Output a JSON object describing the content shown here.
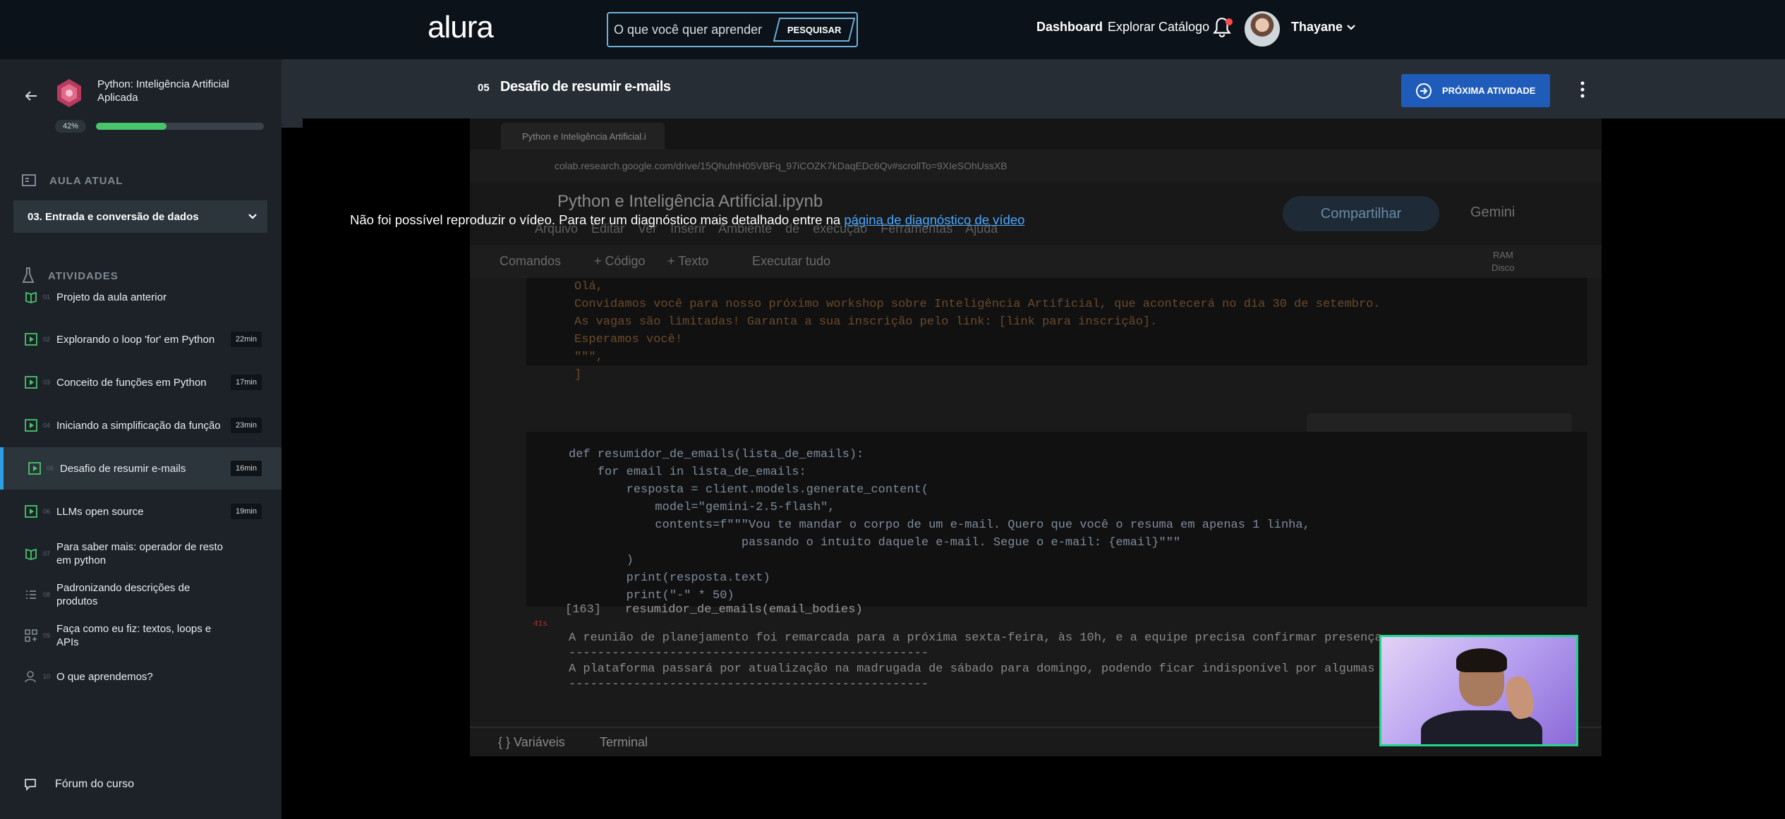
{
  "header": {
    "logo": "alura",
    "search_placeholder": "O que você quer aprender",
    "search_button": "PESQUISAR",
    "nav_dashboard": "Dashboard",
    "nav_catalog": "Explorar Catálogo",
    "user_name": "Thayane"
  },
  "sidebar": {
    "course_title": "Python: Inteligência Artificial Aplicada",
    "progress_label": "42%",
    "progress_percent": 42,
    "current_lesson_heading": "AULA ATUAL",
    "current_lesson": "03. Entrada e conversão de dados",
    "activities_heading": "ATIVIDADES",
    "activities": [
      {
        "num": "01",
        "label": "Projeto da aula anterior",
        "duration": "",
        "icon": "book-icon"
      },
      {
        "num": "02",
        "label": "Explorando o loop 'for' em Python",
        "duration": "22min",
        "icon": "play-icon"
      },
      {
        "num": "03",
        "label": "Conceito de funções em Python",
        "duration": "17min",
        "icon": "play-icon"
      },
      {
        "num": "04",
        "label": "Iniciando a simplificação da função",
        "duration": "23min",
        "icon": "play-icon"
      },
      {
        "num": "05",
        "label": "Desafio de resumir e-mails",
        "duration": "16min",
        "icon": "play-icon"
      },
      {
        "num": "06",
        "label": "LLMs open source",
        "duration": "19min",
        "icon": "play-icon"
      },
      {
        "num": "07",
        "label": "Para saber mais: operador de resto em python",
        "duration": "",
        "icon": "book-icon"
      },
      {
        "num": "08",
        "label": "Padronizando descrições de produtos",
        "duration": "",
        "icon": "list-icon"
      },
      {
        "num": "09",
        "label": "Faça como eu fiz: textos, loops e APIs",
        "duration": "",
        "icon": "code-icon"
      },
      {
        "num": "10",
        "label": "O que aprendemos?",
        "duration": "",
        "icon": "person-icon"
      }
    ],
    "forum_label": "Fórum do curso"
  },
  "content": {
    "step_num": "05",
    "step_title": "Desafio de resumir e-mails",
    "next_button": "PRÓXIMA ATIVIDADE"
  },
  "video": {
    "tab_title": "Python e Inteligência Artificial.i",
    "url": "colab.research.google.com/drive/15QhufnH05VBFq_97iCOZK7kDaqEDc6Qv#scrollTo=9XIeSOhUssXB",
    "notebook_title": "Python e Inteligência Artificial.ipynb",
    "menus": "Arquivo Editar Ver Inserir Ambiente de execução Ferramentas Ajuda",
    "share": "Compartilhar",
    "gemini": "Gemini",
    "toolbar_commands": "Comandos",
    "toolbar_code": "+ Código",
    "toolbar_text": "+ Texto",
    "toolbar_run": "Executar tudo",
    "ram_label": "RAM",
    "disk_label": "Disco",
    "cell1_lines": [
      "Olá,",
      "",
      "Convidamos você para nosso próximo workshop sobre Inteligência Artificial, que acontecerá no dia 30 de setembro.",
      "As vagas são limitadas! Garanta a sua inscrição pelo link: [link para inscrição].",
      "",
      "Esperamos você!",
      "\"\"\",",
      "]"
    ],
    "cell2_lines": [
      "def resumidor_de_emails(lista_de_emails):",
      "    for email in lista_de_emails:",
      "        resposta = client.models.generate_content(",
      "            model=\"gemini-2.5-flash\",",
      "            contents=f\"\"\"Vou te mandar o corpo de um e-mail. Quero que você o resuma em apenas 1 linha,",
      "                        passando o intuito daquele e-mail. Segue o e-mail: {email}\"\"\"",
      "        )",
      "        print(resposta.text)",
      "        print(\"-\" * 50)"
    ],
    "run_count": "[163]",
    "run_time": "41s",
    "run_call": "resumidor_de_emails(email_bodies)",
    "output_lines": [
      "A reunião de planejamento foi remarcada para a próxima sexta-feira, às 10h, e a equipe precisa confirmar presença.",
      "--------------------------------------------------",
      "A plataforma passará por atualização na madrugada de sábado para domingo, podendo ficar indisponível por algumas ho",
      "--------------------------------------------------"
    ],
    "bottom_vars": "{ } Variáveis",
    "bottom_terminal": "Terminal",
    "error_text": "Não foi possível reproduzir o vídeo. Para ter um diagnóstico mais detalhado entre na ",
    "error_link": "página de diagnóstico de vídeo"
  },
  "colors": {
    "accent_green": "#49c46b",
    "accent_blue": "#1f5bb8",
    "active_bar": "#2f9ee6"
  }
}
